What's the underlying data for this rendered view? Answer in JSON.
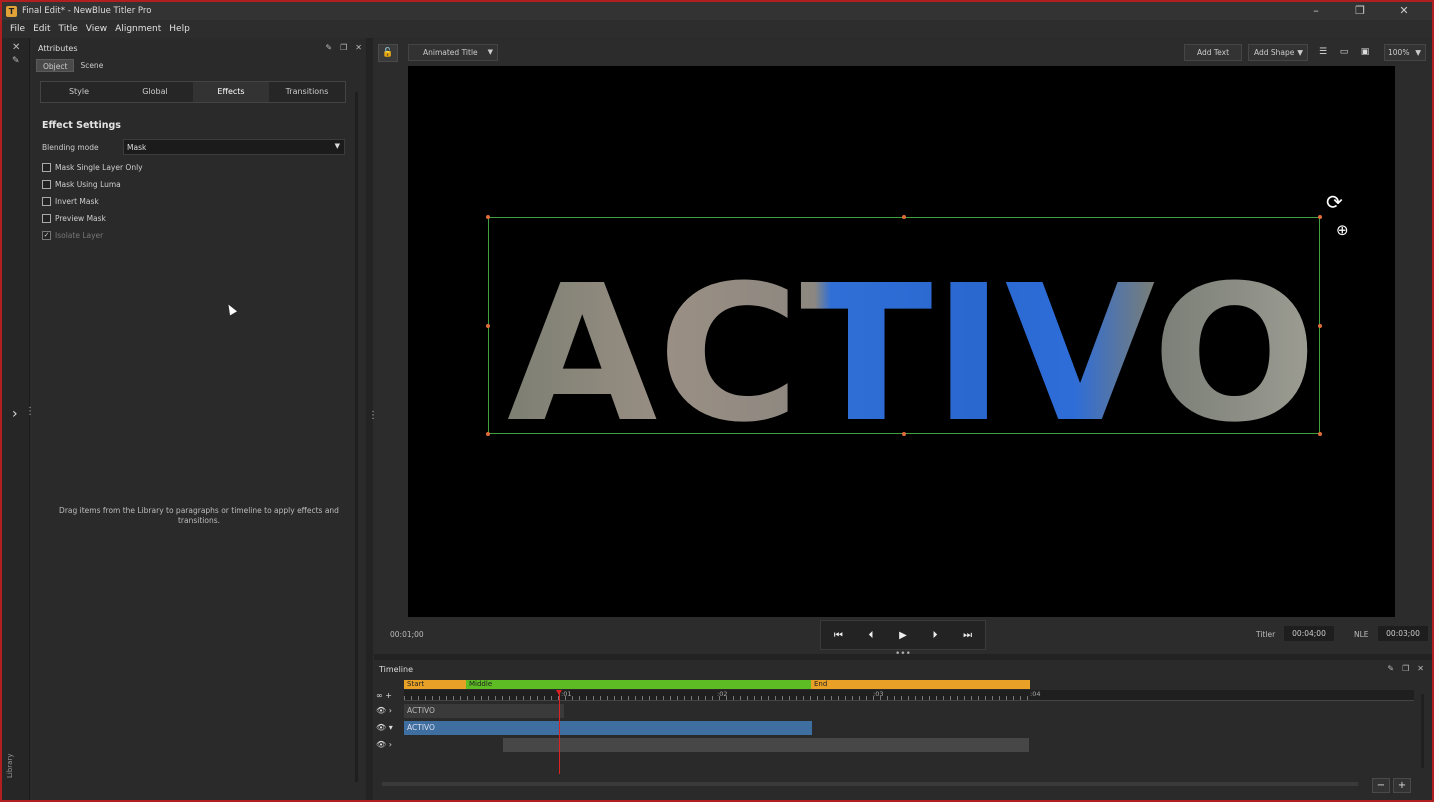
{
  "window": {
    "title": "Final Edit* - NewBlue Titler Pro",
    "controls": {
      "minimize": "–",
      "maximize": "❐",
      "close": "✕"
    }
  },
  "menu": [
    "File",
    "Edit",
    "Title",
    "View",
    "Alignment",
    "Help"
  ],
  "left_strip": {
    "close_glyph": "✕",
    "pin_glyph": "✎",
    "expand_glyph": "›",
    "library_label": "Library"
  },
  "attributes": {
    "title": "Attributes",
    "subtabs": [
      "Object",
      "Scene"
    ],
    "tabs": [
      "Style",
      "Global",
      "Effects",
      "Transitions"
    ],
    "active_tab": "Effects",
    "effect_settings_title": "Effect Settings",
    "blending_label": "Blending mode",
    "blending_value": "Mask",
    "checkboxes": [
      {
        "label": "Mask Single Layer Only",
        "checked": false,
        "disabled": false
      },
      {
        "label": "Mask Using Luma",
        "checked": false,
        "disabled": false
      },
      {
        "label": "Invert Mask",
        "checked": false,
        "disabled": false
      },
      {
        "label": "Preview Mask",
        "checked": false,
        "disabled": false
      },
      {
        "label": "Isolate Layer",
        "checked": true,
        "disabled": true
      }
    ],
    "drag_hint": "Drag items from the Library to paragraphs or timeline to apply effects and transitions."
  },
  "preview": {
    "title_dropdown": "Animated Title",
    "add_text": "Add Text",
    "add_shape": "Add Shape",
    "zoom": "100%",
    "title_text": "ACTIVO",
    "current_time": "00:01;00",
    "titler_label": "Titler",
    "titler_duration": "00:04;00",
    "nle_label": "NLE",
    "nle_duration": "00:03;00",
    "transport": [
      "⏮",
      "⏴",
      "▶",
      "⏵",
      "⏭"
    ]
  },
  "timeline": {
    "title": "Timeline",
    "segments": {
      "start": "Start",
      "middle": "Middle",
      "end": "End"
    },
    "ruler": [
      ":01",
      ":02",
      ":03",
      ":04"
    ],
    "tracks": [
      {
        "label": "ACTIVO"
      },
      {
        "label": "ACTIVO"
      },
      {
        "label": ""
      }
    ],
    "zoom_out": "−",
    "zoom_in": "+"
  },
  "colors": {
    "selection": "#3ea13e",
    "playhead": "#dd2222",
    "segment_start_end": "#e8a126",
    "segment_middle": "#5dbb24",
    "track_selected": "#3f6fa0",
    "window_border": "#b02020"
  }
}
